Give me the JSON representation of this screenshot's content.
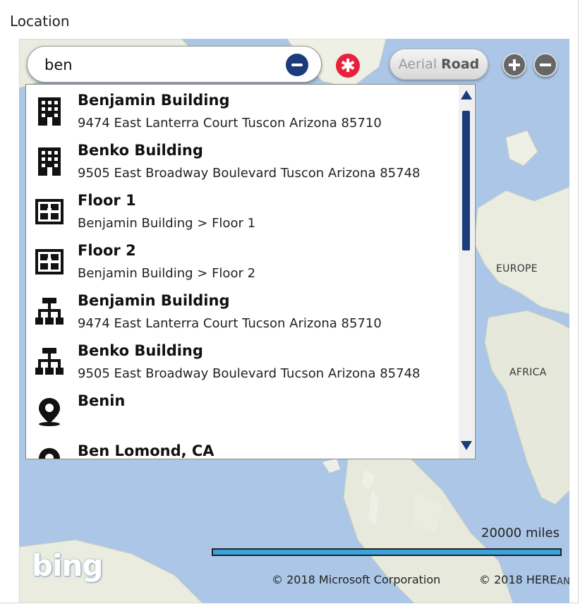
{
  "section": {
    "title": "Location"
  },
  "search": {
    "value": "ben"
  },
  "map_controls": {
    "view_aerial": "Aerial",
    "view_road": "Road",
    "selected_view": "Road"
  },
  "results": [
    {
      "title": "Benjamin Building",
      "subtitle": "9474 East Lanterra Court  Tuscon Arizona 85710",
      "icon": "building-icon"
    },
    {
      "title": "Benko Building",
      "subtitle": "9505 East Broadway Boulevard  Tuscon Arizona 85748",
      "icon": "building-icon"
    },
    {
      "title": "Floor 1",
      "subtitle": "Benjamin Building > Floor 1",
      "icon": "floor-plan-icon"
    },
    {
      "title": "Floor 2",
      "subtitle": "Benjamin Building > Floor 2",
      "icon": "floor-plan-icon"
    },
    {
      "title": "Benjamin Building",
      "subtitle": "9474 East Lanterra Court  Tucson Arizona 85710",
      "icon": "hierarchy-icon"
    },
    {
      "title": "Benko Building",
      "subtitle": "9505 East Broadway Boulevard  Tucson Arizona 85748",
      "icon": "hierarchy-icon"
    },
    {
      "title": "Benin",
      "subtitle": "",
      "icon": "map-pin-icon"
    },
    {
      "title": "Ben Lomond, CA",
      "subtitle": "",
      "icon": "map-pin-icon"
    }
  ],
  "map": {
    "label_europe": "EUROPE",
    "label_africa": "AFRICA",
    "label_an": "AN",
    "scale_text": "20000 miles",
    "copyright_microsoft": "© 2018 Microsoft Corporation",
    "copyright_here": "© 2018 HERE",
    "logo_text": "bing"
  },
  "colors": {
    "accent": "#1a3c7a",
    "clear": "#e8203a",
    "water": "#abc6e6",
    "scale_bar": "#3ba3dc"
  }
}
